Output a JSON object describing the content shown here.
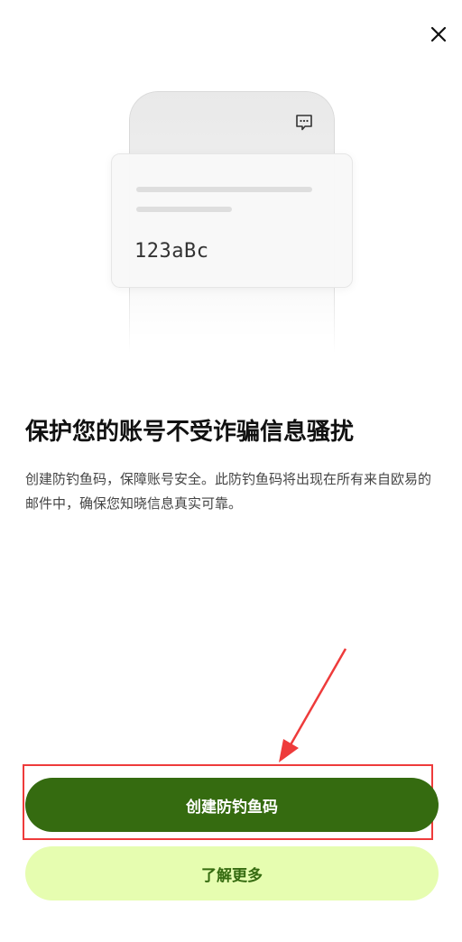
{
  "illustration": {
    "code_text": "123aBc"
  },
  "content": {
    "title": "保护您的账号不受诈骗信息骚扰",
    "description": "创建防钓鱼码，保障账号安全。此防钓鱼码将出现在所有来自欧易的邮件中，确保您知晓信息真实可靠。"
  },
  "buttons": {
    "primary_label": "创建防钓鱼码",
    "secondary_label": "了解更多"
  },
  "icons": {
    "close": "close-icon",
    "message": "message-icon"
  },
  "colors": {
    "primary_button": "#356b10",
    "secondary_button": "#e6fdb0",
    "annotation": "#ee3b3b"
  }
}
